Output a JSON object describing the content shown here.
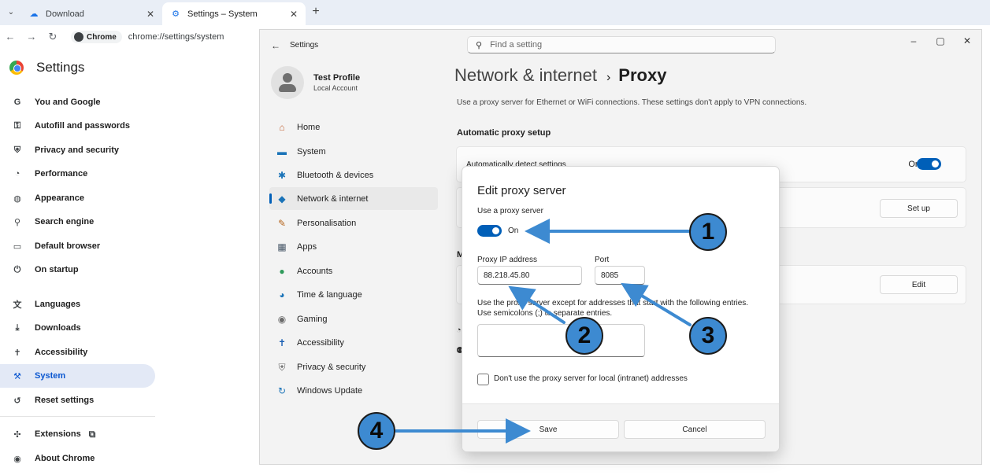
{
  "browser": {
    "tabs": [
      {
        "title": "Download",
        "close": "✕"
      },
      {
        "title": "Settings – System",
        "close": "✕"
      }
    ],
    "new_tab": "+",
    "chip_label": "Chrome",
    "url": "chrome://settings/system"
  },
  "chrome_settings": {
    "title": "Settings",
    "items": [
      {
        "label": "You and Google",
        "icon": "G"
      },
      {
        "label": "Autofill and passwords",
        "icon": "⚿"
      },
      {
        "label": "Privacy and security",
        "icon": "⛨"
      },
      {
        "label": "Performance",
        "icon": "◔"
      },
      {
        "label": "Appearance",
        "icon": "◍"
      },
      {
        "label": "Search engine",
        "icon": "⚲"
      },
      {
        "label": "Default browser",
        "icon": "▭"
      },
      {
        "label": "On startup",
        "icon": "⏻"
      },
      {
        "label": "Languages",
        "icon": "文"
      },
      {
        "label": "Downloads",
        "icon": "⤓"
      },
      {
        "label": "Accessibility",
        "icon": "✝"
      },
      {
        "label": "System",
        "icon": "⚒"
      },
      {
        "label": "Reset settings",
        "icon": "↺"
      },
      {
        "label": "Extensions",
        "icon": "✣"
      },
      {
        "label": "About Chrome",
        "icon": "◉"
      }
    ],
    "active_index": 11
  },
  "windows_settings": {
    "window_title": "Settings",
    "search_placeholder": "Find a setting",
    "profile": {
      "name": "Test Profile",
      "sub": "Local Account"
    },
    "nav": [
      {
        "label": "Home",
        "icon": "⌂",
        "color": "#c06030"
      },
      {
        "label": "System",
        "icon": "▬",
        "color": "#1a73b8"
      },
      {
        "label": "Bluetooth & devices",
        "icon": "✱",
        "color": "#1a73b8"
      },
      {
        "label": "Network & internet",
        "icon": "◆",
        "color": "#1a73b8"
      },
      {
        "label": "Personalisation",
        "icon": "✎",
        "color": "#b5651d"
      },
      {
        "label": "Apps",
        "icon": "▦",
        "color": "#4a5a6a"
      },
      {
        "label": "Accounts",
        "icon": "●",
        "color": "#2e9a5a"
      },
      {
        "label": "Time & language",
        "icon": "◕",
        "color": "#1a73b8"
      },
      {
        "label": "Gaming",
        "icon": "◉",
        "color": "#6a6a6a"
      },
      {
        "label": "Accessibility",
        "icon": "✝",
        "color": "#1a5fb4"
      },
      {
        "label": "Privacy & security",
        "icon": "⛨",
        "color": "#6a6a6a"
      },
      {
        "label": "Windows Update",
        "icon": "↻",
        "color": "#1a73b8"
      }
    ],
    "breadcrumb_parent": "Network & internet",
    "breadcrumb_sep": "›",
    "breadcrumb_current": "Proxy",
    "description": "Use a proxy server for Ethernet or WiFi connections. These settings don't apply to VPN connections.",
    "section_auto": "Automatic proxy setup",
    "section_manual_partial": "M",
    "auto_detect_label": "Automatically detect settings",
    "auto_detect_state": "On",
    "setup_button": "Set up",
    "edit_button": "Edit"
  },
  "dialog": {
    "title": "Edit proxy server",
    "use_proxy_label": "Use a proxy server",
    "use_proxy_state": "On",
    "ip_label": "Proxy IP address",
    "ip_value": "88.218.45.80",
    "port_label": "Port",
    "port_value": "8085",
    "exceptions_note_1": "Use the proxy server except for addresses that start with the following entries.",
    "exceptions_note_2": "Use semicolons (;) to separate entries.",
    "local_checkbox_label": "Don't use the proxy server for local (intranet) addresses",
    "save_label": "Save",
    "cancel_label": "Cancel"
  },
  "annotations": {
    "badges": [
      "1",
      "2",
      "3",
      "4"
    ],
    "color": "#3d8ad1"
  }
}
